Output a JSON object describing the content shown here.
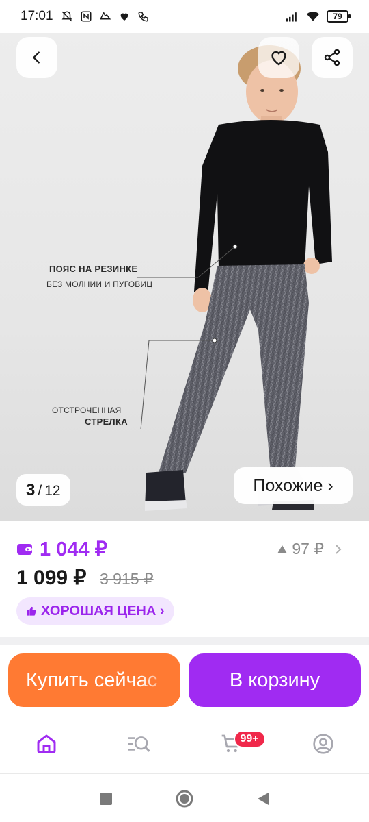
{
  "status_bar": {
    "time": "17:01",
    "battery": "79",
    "icons_left": [
      "mute-bell-icon",
      "nfc-icon",
      "running-shoe-icon",
      "heart-icon",
      "wifi-call-icon"
    ],
    "icons_right": [
      "signal-icon",
      "wifi-icon",
      "battery-icon"
    ]
  },
  "gallery": {
    "current": "3",
    "separator": "/",
    "total": "12",
    "similar_label": "Похожие ›"
  },
  "annotations": {
    "waist_title": "ПОЯС НА РЕЗИНКЕ",
    "waist_sub": "БЕЗ МОЛНИИ И ПУГОВИЦ",
    "crease_line1": "ОТСТРОЧЕННАЯ",
    "crease_line2": "СТРЕЛКА"
  },
  "price": {
    "wallet_price": "1 044 ₽",
    "points": "97 ₽",
    "current": "1 099 ₽",
    "old": "3 915 ₽",
    "badge": "ХОРОШАЯ ЦЕНА ›"
  },
  "actions": {
    "buy_now": "Купить сейчас",
    "add_to_cart": "В корзину"
  },
  "bottom_nav": {
    "cart_badge": "99+"
  },
  "colors": {
    "accent_purple": "#a02bf2",
    "buy_orange": "#ff7a33",
    "badge_red": "#f0284a",
    "badge_bg": "#f2e6fe"
  }
}
